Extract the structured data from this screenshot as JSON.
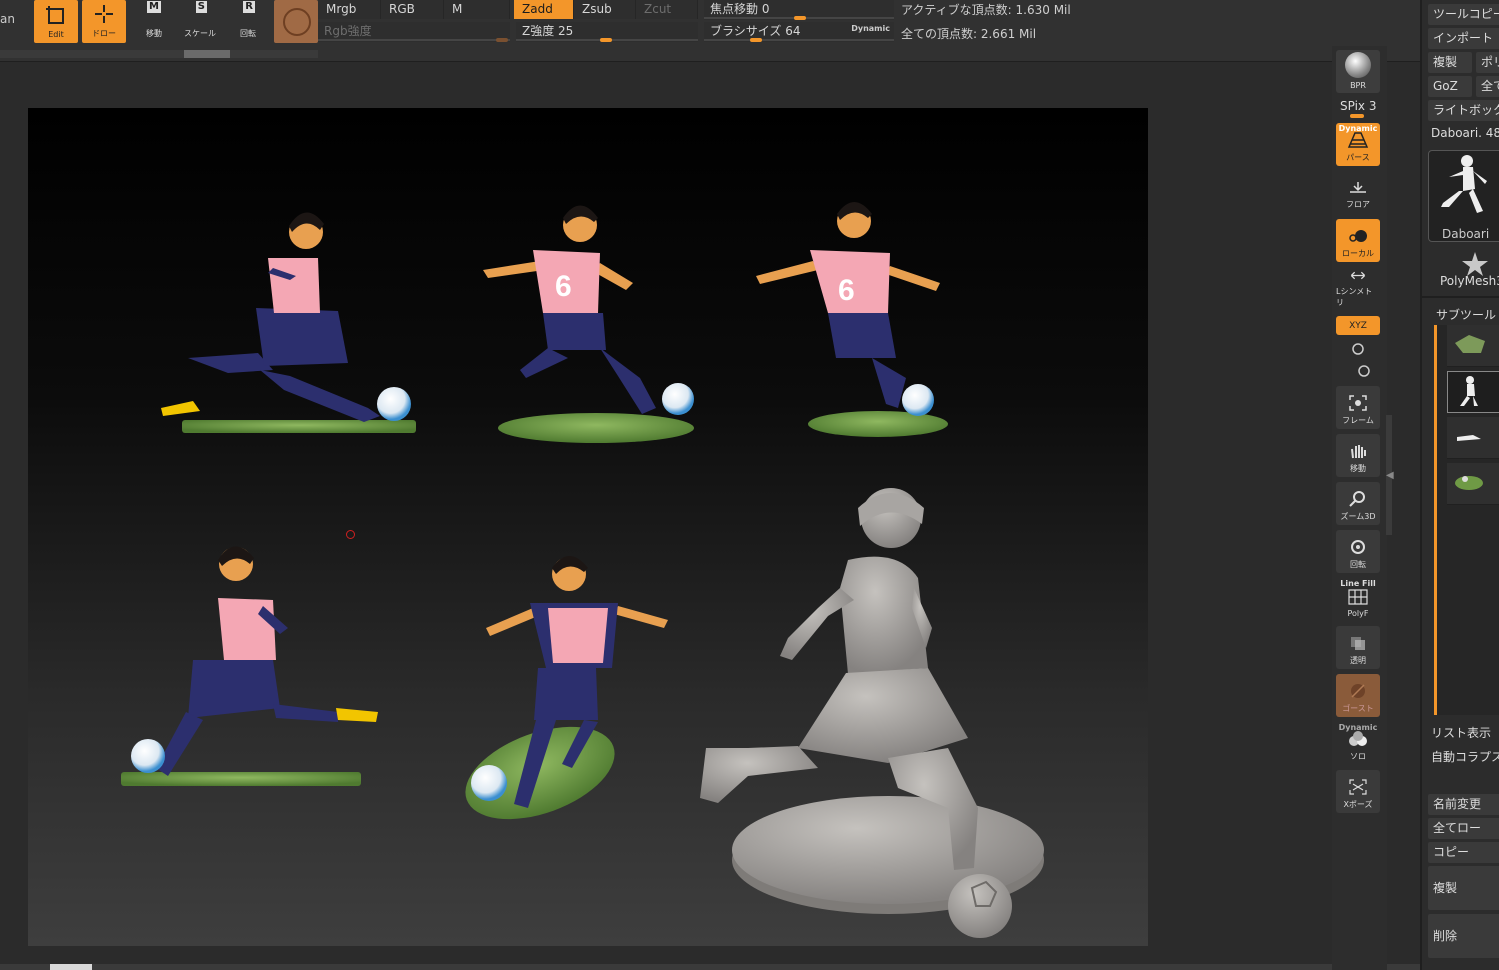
{
  "top": {
    "cut_label": "an",
    "buttons": [
      {
        "id": "edit",
        "label": "Edit",
        "key": ""
      },
      {
        "id": "draw",
        "label": "ドロー",
        "key": ""
      },
      {
        "id": "move",
        "label": "移動",
        "key": "M"
      },
      {
        "id": "scale",
        "label": "スケール",
        "key": "S"
      },
      {
        "id": "rotate",
        "label": "回転",
        "key": "R"
      }
    ],
    "modes_row1": [
      "Mrgb",
      "RGB",
      "M"
    ],
    "modes_row2": [
      "Zadd",
      "Zsub",
      "Zcut"
    ],
    "rgb_intensity": "Rgb強度",
    "z_intensity": "Z強度 25",
    "focal_shift": "焦点移動 0",
    "brush_size": "ブラシサイズ 64",
    "dynamic_label": "Dynamic",
    "active_points": "アクティブな頂点数: 1.630 Mil",
    "total_points": "全ての頂点数: 2.661 Mil"
  },
  "shelf": {
    "bpr": "BPR",
    "spix": "SPix 3",
    "dynamic": "Dynamic",
    "persp": "パース",
    "floor": "フロア",
    "local": "ローカル",
    "symmetry": "Lシンメトリ",
    "xyz": "XYZ",
    "frame": "フレーム",
    "move": "移動",
    "zoom": "ズーム3D",
    "rotate": "回転",
    "linefill": "Line Fill",
    "polyf": "PolyF",
    "transp": "透明",
    "ghost": "ゴースト",
    "solo": "ソロ",
    "xpose": "Xポーズ"
  },
  "palette": {
    "tool_copy": "ツールコピー",
    "import": "インポート",
    "dup": "複製",
    "poly": "ポリ",
    "goz": "GoZ",
    "all": "全て",
    "lightbox": "ライトボックス",
    "current_tool": "Daboari. 48",
    "thumb_caption": "Daboari",
    "polymesh": "PolyMesh3",
    "subtool_title": "サブツール",
    "list_view": "リスト表示",
    "auto_collapse": "自動コラプス",
    "rename": "名前変更",
    "all_low": "全てロー",
    "copy": "コピー",
    "duplicate": "複製",
    "delete": "削除"
  },
  "colors": {
    "accent": "#f3962a",
    "jersey": "#f4a7b4",
    "shorts": "#2c2f6e",
    "skin": "#e8a050",
    "grass": "#6f9a45",
    "clay": "#9a9794"
  }
}
